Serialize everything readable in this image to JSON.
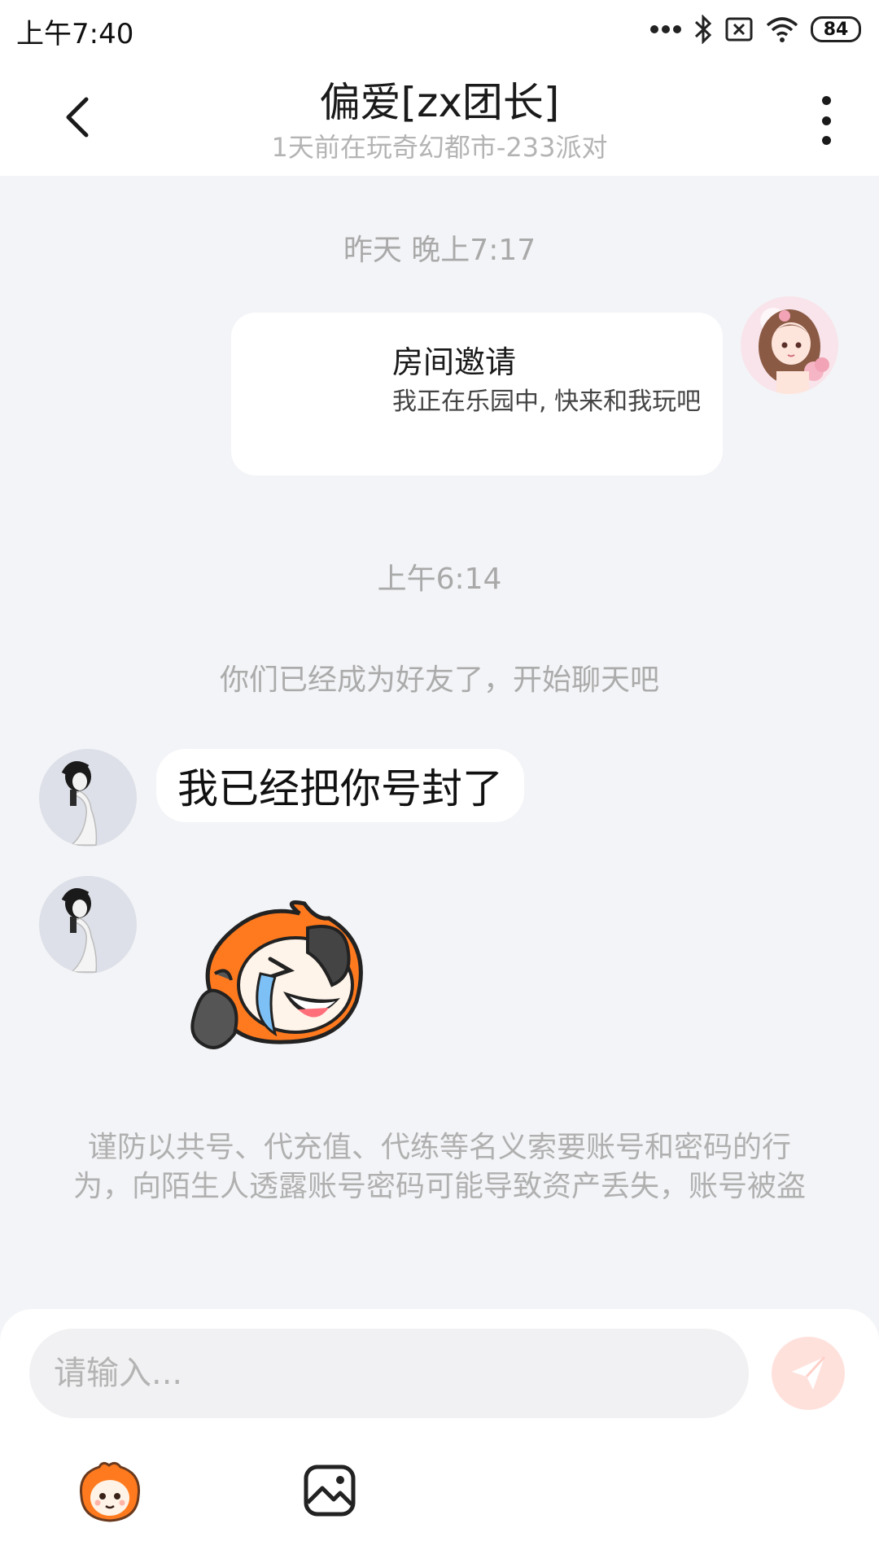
{
  "status_bar": {
    "time": "上午7:40",
    "battery": "84",
    "icons": [
      "more-dots-icon",
      "bluetooth-icon",
      "no-sim-icon",
      "wifi-icon",
      "battery-icon"
    ]
  },
  "header": {
    "title": "偏爱[zx团长]",
    "subtitle": "1天前在玩奇幻都市-233派对",
    "icons": [
      "back-arrow-icon",
      "more-vertical-icon"
    ]
  },
  "chat": {
    "timestamp_1": "昨天 晚上7:17",
    "invite": {
      "title": "房间邀请",
      "body": "我正在乐园中, 快来和我玩吧"
    },
    "timestamp_2": "上午6:14",
    "system_msg": "你们已经成为好友了，开始聊天吧",
    "message_1": "我已经把你号封了",
    "warning": "谨防以共号、代充值、代练等名义索要账号和密码的行为，向陌生人透露账号密码可能导致资产丢失，账号被盗"
  },
  "input": {
    "placeholder": "请输入...",
    "icons": [
      "send-icon",
      "emoji-sticker-icon",
      "image-icon"
    ]
  },
  "colors": {
    "chat_background": "#f3f4f7",
    "send_button": "#ffe1dc",
    "send_icon": "#ffffff",
    "sticker_orange": "#ff7a1e"
  }
}
